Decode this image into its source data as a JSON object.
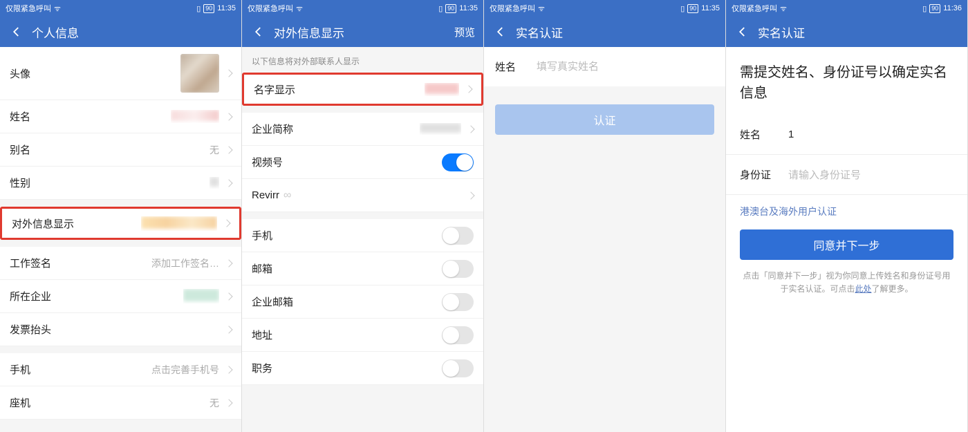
{
  "status": {
    "carrier": "仅限紧急呼叫",
    "battery": "90",
    "time_a": "11:35",
    "time_d": "11:36"
  },
  "screen1": {
    "title": "个人信息",
    "items": {
      "avatar": "头像",
      "name": "姓名",
      "alias": "别名",
      "alias_value": "无",
      "gender": "性别",
      "external_display": "对外信息显示",
      "signature": "工作签名",
      "signature_value": "添加工作签名…",
      "company": "所在企业",
      "invoice": "发票抬头",
      "phone": "手机",
      "phone_value": "点击完善手机号",
      "landline": "座机",
      "landline_value": "无"
    }
  },
  "screen2": {
    "title": "对外信息显示",
    "preview": "预览",
    "hint": "以下信息将对外部联系人显示",
    "items": {
      "name_display": "名字显示",
      "company_short": "企业简称",
      "video_account": "视频号",
      "revirr": "Revirr",
      "phone": "手机",
      "email": "邮箱",
      "company_email": "企业邮箱",
      "address": "地址",
      "position": "职务"
    },
    "toggles": {
      "video_account": true,
      "phone": false,
      "email": false,
      "company_email": false,
      "address": false,
      "position": false
    }
  },
  "screen3": {
    "title": "实名认证",
    "name_label": "姓名",
    "name_placeholder": "填写真实姓名",
    "verify_btn": "认证"
  },
  "screen4": {
    "title": "实名认证",
    "heading": "需提交姓名、身份证号以确定实名信息",
    "name_label": "姓名",
    "name_value": "1",
    "id_label": "身份证",
    "id_placeholder": "请输入身份证号",
    "overseas_link": "港澳台及海外用户认证",
    "agree_btn": "同意并下一步",
    "footnote_a": "点击「同意并下一步」视为你同意上传姓名和身份证号用于实名认证。可点击",
    "footnote_link": "此处",
    "footnote_b": "了解更多。"
  }
}
